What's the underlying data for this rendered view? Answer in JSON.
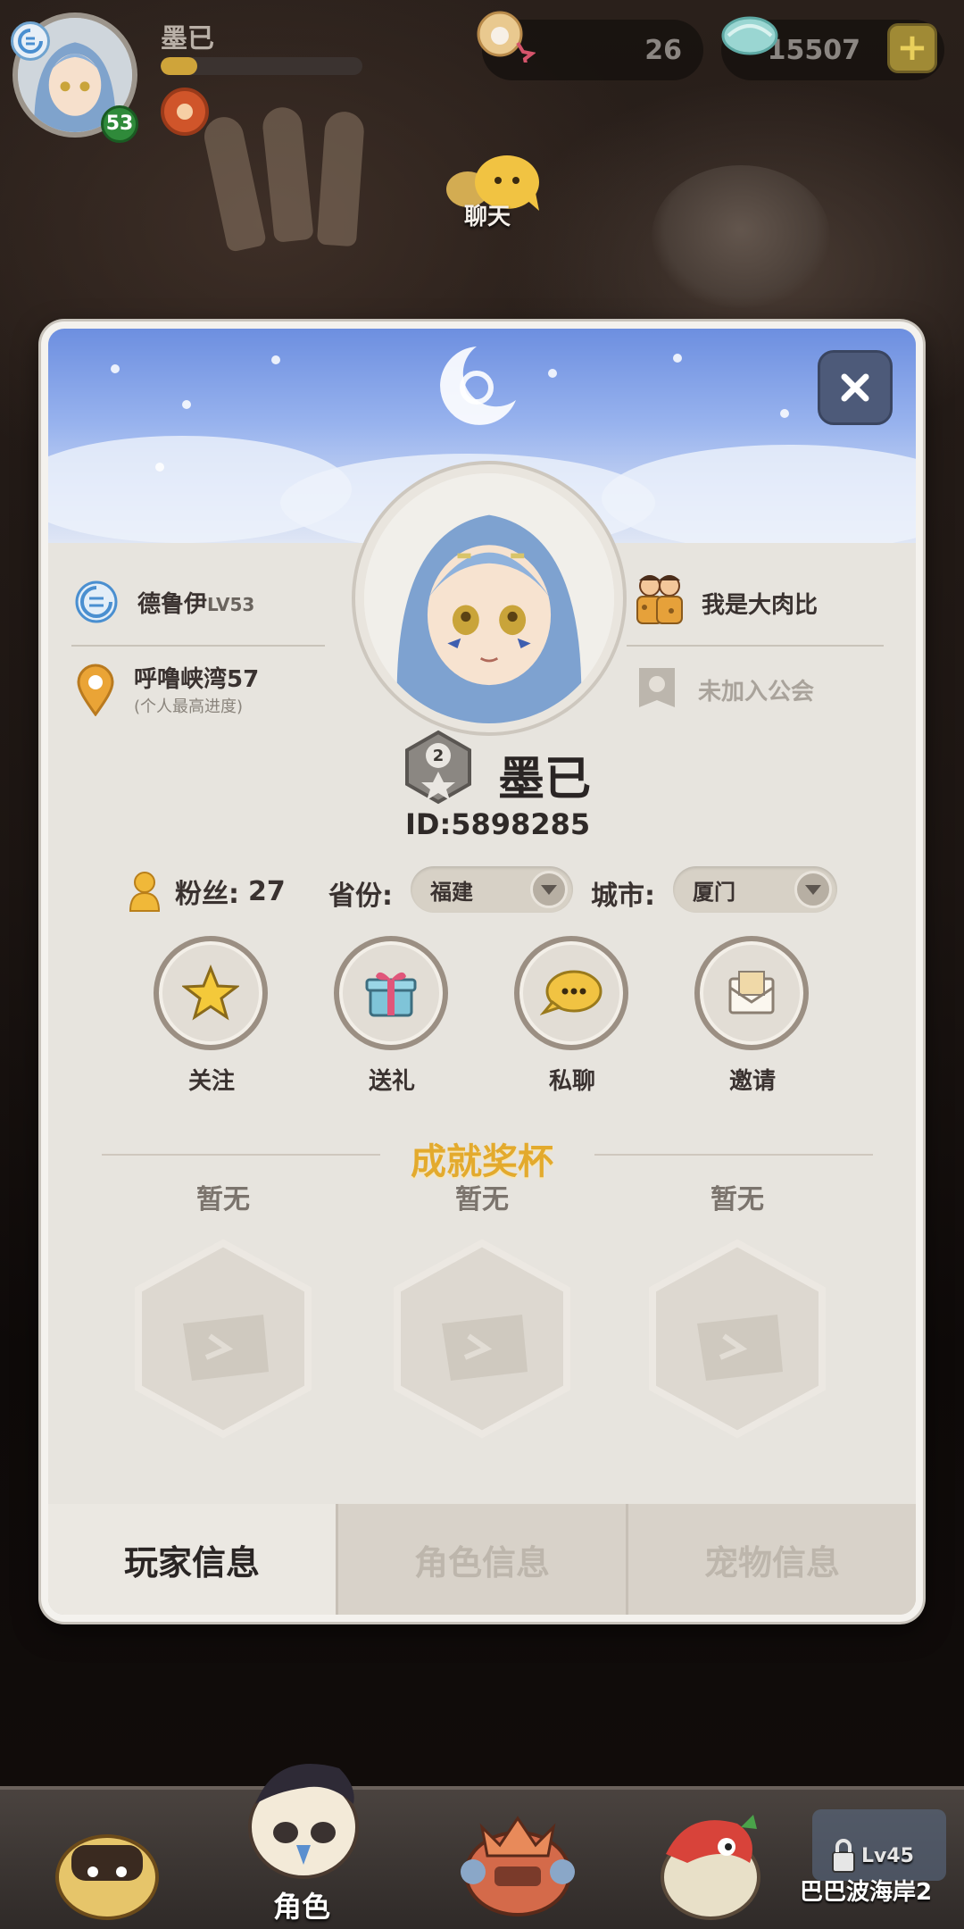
{
  "hud": {
    "player_name": "墨已",
    "level": "53",
    "exp_progress": 0.18,
    "shells": "26",
    "gems": "15507",
    "add_label": "+",
    "chat_label": "聊天"
  },
  "profile": {
    "class_name": "德鲁伊",
    "class_level": "LV53",
    "location": "呼噜峡湾57",
    "location_note": "(个人最高进度)",
    "partner": "我是大肉比",
    "guild": "未加入公会",
    "rank": "2",
    "name": "墨已",
    "id": "ID:5898285",
    "fans_label": "粉丝:",
    "fans_count": "27",
    "province_label": "省份:",
    "province_value": "福建",
    "city_label": "城市:",
    "city_value": "厦门"
  },
  "actions": [
    {
      "label": "关注",
      "icon": "star-icon"
    },
    {
      "label": "送礼",
      "icon": "gift-icon"
    },
    {
      "label": "私聊",
      "icon": "chat-icon"
    },
    {
      "label": "邀请",
      "icon": "mail-icon"
    }
  ],
  "achievements": {
    "title": "成就奖杯",
    "slots": [
      "暂无",
      "暂无",
      "暂无"
    ]
  },
  "tabs": [
    "玩家信息",
    "角色信息",
    "宠物信息"
  ],
  "bottom_bar": {
    "active_label": "角色",
    "locked_level": "Lv45",
    "locked_label": "巴巴波海岸2"
  },
  "colors": {
    "accent_gold": "#e3aa2d",
    "banner_blue": "#7c9ee6",
    "level_green": "#2f8a3a"
  }
}
